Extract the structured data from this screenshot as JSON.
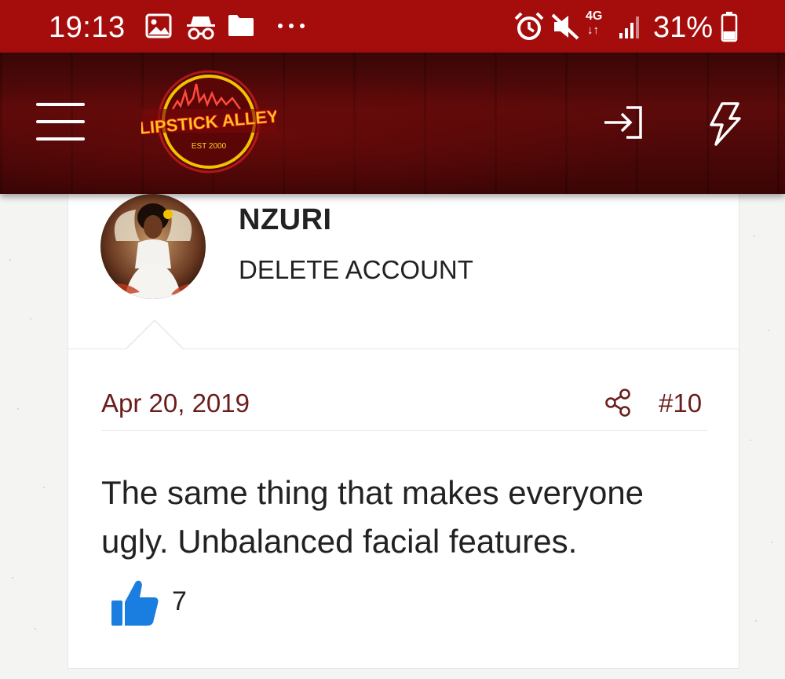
{
  "status_bar": {
    "time": "19:13",
    "network": "4G",
    "battery": "31%",
    "icons": [
      "image-icon",
      "incognito-icon",
      "folder-icon",
      "more-icon",
      "alarm-icon",
      "mute-icon",
      "network-4g-icon",
      "signal-icon",
      "battery-icon"
    ]
  },
  "header": {
    "logo_text": "LIPSTICK ALLEY",
    "logo_subtext": "EST 2000",
    "icons": [
      "menu-icon",
      "login-icon",
      "lightning-icon"
    ]
  },
  "post": {
    "username": "NZURI",
    "user_title": "DELETE ACCOUNT",
    "date": "Apr 20, 2019",
    "post_number": "#10",
    "body_lines": [
      "The same thing that makes everyone",
      "ugly. Unbalanced facial features."
    ],
    "like_count": "7"
  },
  "colors": {
    "status_bar": "#a50d0d",
    "header": "#5c0a0a",
    "meta_text": "#6b1c1c",
    "like_blue": "#1a7ee0"
  }
}
